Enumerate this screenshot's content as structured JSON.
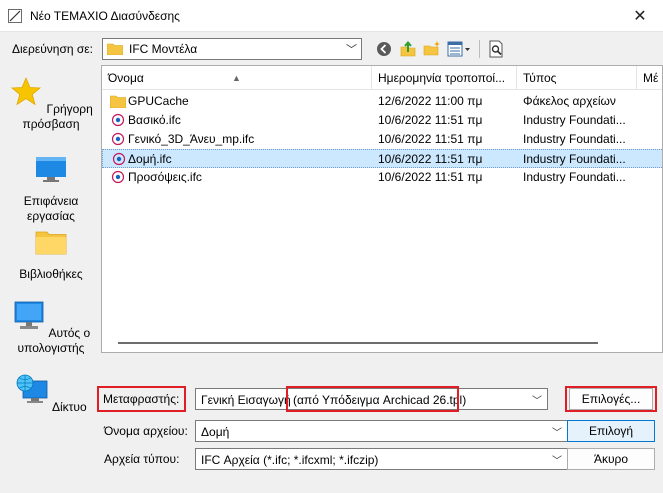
{
  "window": {
    "title": "Νέο ΤΕΜΑΧΙΟ Διασύνδεσης",
    "close": "✕"
  },
  "lookin": {
    "label": "Διερεύνηση σε:",
    "value": "IFC Μοντέλα"
  },
  "places": [
    {
      "label": "Γρήγορη πρόσβαση",
      "icon": "star-icon"
    },
    {
      "label": "Επιφάνεια εργασίας",
      "icon": "desktop-icon"
    },
    {
      "label": "Βιβλιοθήκες",
      "icon": "libraries-folder-icon"
    },
    {
      "label": "Αυτός ο υπολογιστής",
      "icon": "computer-icon"
    },
    {
      "label": "Δίκτυο",
      "icon": "network-icon"
    }
  ],
  "columns": [
    {
      "label": "Όνομα"
    },
    {
      "label": "Ημερομηνία τροποποί..."
    },
    {
      "label": "Τύπος"
    },
    {
      "label": "Μέ"
    }
  ],
  "files": [
    {
      "name": "GPUCache",
      "date": "12/6/2022 11:00 πμ",
      "type": "Φάκελος αρχείων",
      "icon": "folder-icon"
    },
    {
      "name": "Βασικό.ifc",
      "date": "10/6/2022 11:51 πμ",
      "type": "Industry Foundati...",
      "icon": "ifc-file-icon"
    },
    {
      "name": "Γενικό_3D_Άνευ_mp.ifc",
      "date": "10/6/2022 11:51 πμ",
      "type": "Industry Foundati...",
      "icon": "ifc-file-icon"
    },
    {
      "name": "Δομή.ifc",
      "date": "10/6/2022 11:51 πμ",
      "type": "Industry Foundati...",
      "icon": "ifc-file-icon",
      "selected": true
    },
    {
      "name": "Προσόψεις.ifc",
      "date": "10/6/2022 11:51 πμ",
      "type": "Industry Foundati...",
      "icon": "ifc-file-icon"
    }
  ],
  "translator": {
    "label": "Μεταφραστής:",
    "value_part1": "Γενική Εισαγωγή",
    "value_part2": "(από Υπόδειγμα Archicad 26.tpl)",
    "options_button": "Επιλογές..."
  },
  "filename": {
    "label": "Όνομα αρχείου:",
    "value": "Δομή",
    "open_button": "Επιλογή"
  },
  "filetype": {
    "label": "Αρχεία τύπου:",
    "value": "IFC Αρχεία (*.ifc; *.ifcxml; *.ifczip)",
    "cancel_button": "Άκυρο"
  },
  "colors": {
    "highlight": "#e01e26",
    "selection": "#cce8ff",
    "accent": "#0078d4"
  }
}
